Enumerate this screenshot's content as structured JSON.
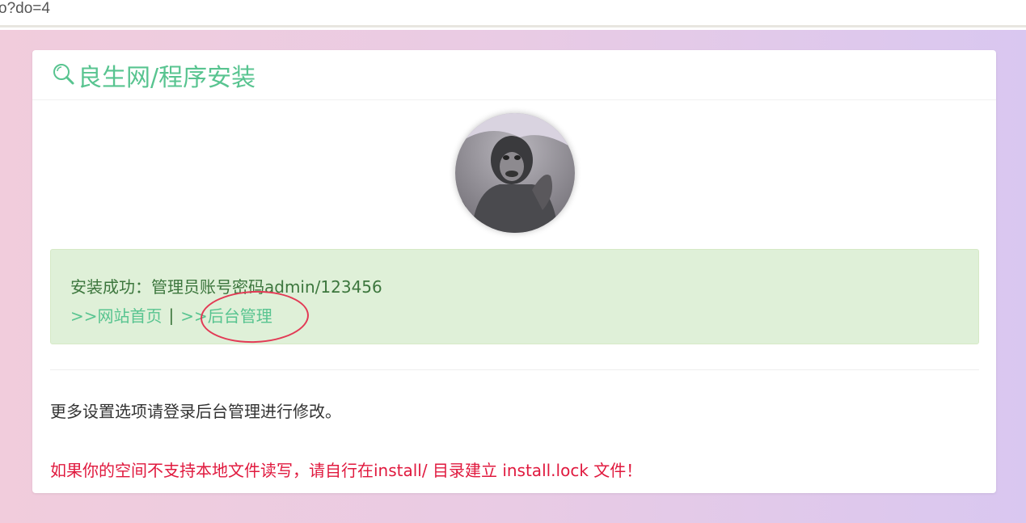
{
  "browser": {
    "url_fragment": "o?do=4"
  },
  "panel": {
    "title": "良生网/程序安装",
    "title_icon": "search-icon"
  },
  "alert": {
    "message": "安装成功：管理员账号密码admin/123456",
    "link_home": ">>网站首页",
    "separator": "|",
    "link_admin": ">>后台管理"
  },
  "info_text": "更多设置选项请登录后台管理进行修改。",
  "warning_text": "如果你的空间不支持本地文件读写，请自行在install/ 目录建立 install.lock 文件！",
  "colors": {
    "accent_green": "#58c490",
    "alert_bg": "#dff0d8",
    "warning_red": "#e0193e",
    "annotation_red": "#e23a55"
  }
}
